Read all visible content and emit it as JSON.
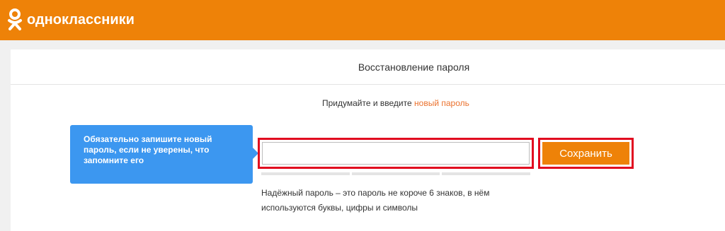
{
  "header": {
    "logo_text": "одноклассники",
    "brand_color": "#ee8208"
  },
  "panel": {
    "title": "Восстановление пароля"
  },
  "instruction": {
    "prefix": "Придумайте и введите ",
    "highlight": "новый пароль"
  },
  "tooltip": {
    "text": "Обязательно запишите новый пароль, если не уверены, что запомните его"
  },
  "password_field": {
    "value": "",
    "placeholder": ""
  },
  "save_button": {
    "label": "Сохранить"
  },
  "hint": {
    "text": "Надёжный пароль – это пароль не короче 6 знаков, в нём используются буквы, цифры и символы"
  },
  "colors": {
    "accent": "#ee8208",
    "link": "#eb722e",
    "tooltip": "#3c97f0",
    "highlight_frame": "#e10a1f"
  }
}
